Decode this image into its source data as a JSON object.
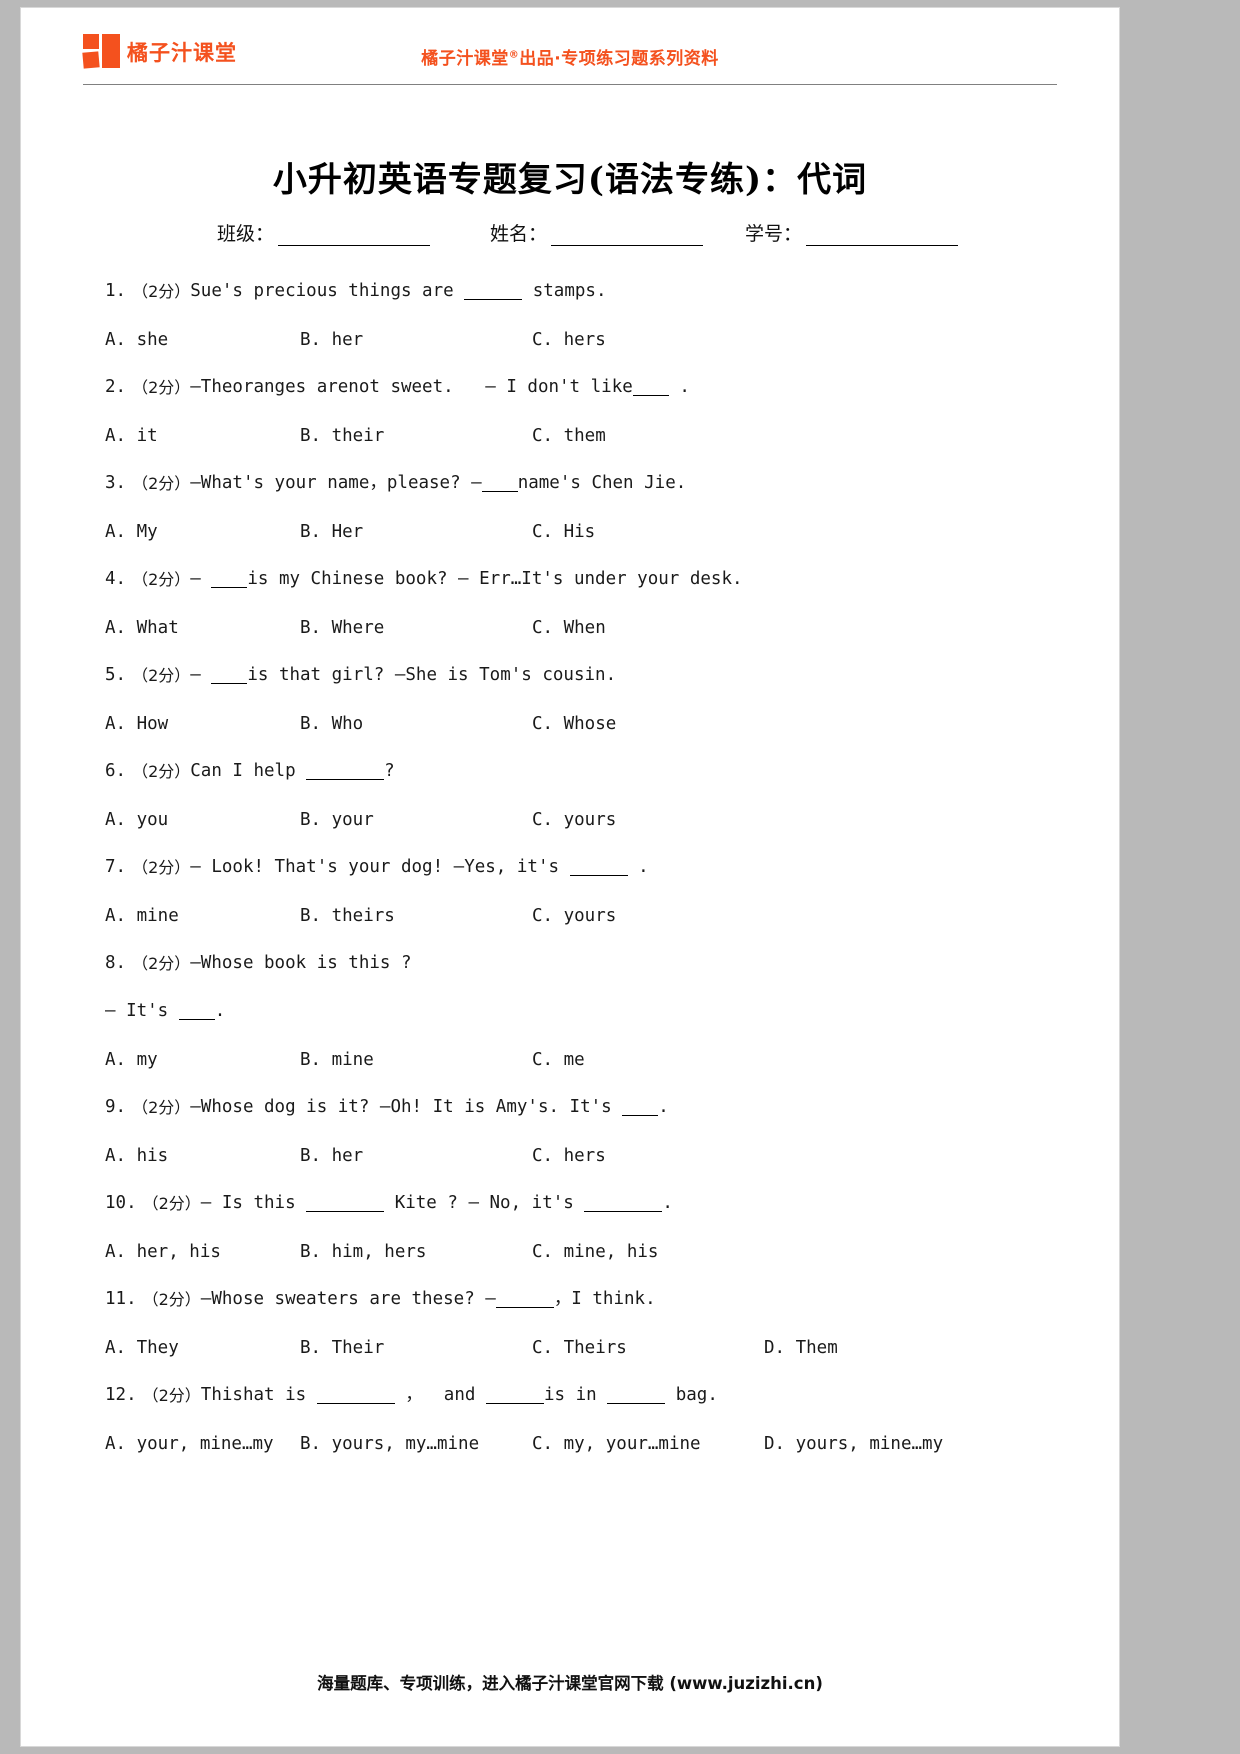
{
  "brand": {
    "logo_text": "橘子汁课堂",
    "logo_color": "#f4511e",
    "slogan_prefix": "橘子汁课堂",
    "slogan_mark": "®",
    "slogan_suffix": "出品·专项练习题系列资料"
  },
  "document": {
    "title": "小升初英语专题复习(语法专练)：代词",
    "info": {
      "class_label": "班级：",
      "name_label": "姓名：",
      "id_label": "学号："
    }
  },
  "questions": [
    {
      "number": "1.",
      "score": "（2分）",
      "stem_before": "Sue's precious things are ",
      "blank": "m",
      "stem_after": " stamps.",
      "options": [
        "A. she",
        "B. her",
        "C. hers"
      ]
    },
    {
      "number": "2.",
      "score": "（2分）",
      "stem_before": "—Theoranges arenot sweet.   — I don't like",
      "blank": "s",
      "stem_after": " .",
      "options": [
        "A. it",
        "B. their",
        "C. them"
      ]
    },
    {
      "number": "3.",
      "score": "（2分）",
      "stem_before": "—What's your name，please? —",
      "blank": "s",
      "stem_after": "name's Chen Jie.",
      "options": [
        "A. My",
        "B. Her",
        "C. His"
      ]
    },
    {
      "number": "4.",
      "score": "（2分）",
      "stem_before": "— ",
      "blank": "s",
      "stem_after": "is my Chinese book? — Err…It's under your desk.",
      "options": [
        "A. What",
        "B. Where",
        "C. When"
      ]
    },
    {
      "number": "5.",
      "score": "（2分）",
      "stem_before": "— ",
      "blank": "s",
      "stem_after": "is that girl? —She is Tom's cousin.",
      "options": [
        "A. How",
        "B. Who",
        "C. Whose"
      ]
    },
    {
      "number": "6.",
      "score": "（2分）",
      "stem_before": "Can I help ",
      "blank": "l",
      "stem_after": "?",
      "options": [
        "A. you",
        "B. your",
        "C. yours"
      ]
    },
    {
      "number": "7.",
      "score": "（2分）",
      "stem_before": "— Look! That's your dog! —Yes, it's ",
      "blank": "m",
      "stem_after": " .",
      "options": [
        "A. mine",
        "B. theirs",
        "C. yours"
      ]
    },
    {
      "number": "8.",
      "score": "（2分）",
      "stem_before": "—Whose book is this ?",
      "blank": "none",
      "stem_after": "",
      "line2_before": "— It's ",
      "line2_blank": "s",
      "line2_after": ".",
      "options": [
        "A. my",
        "B. mine",
        "C. me"
      ]
    },
    {
      "number": "9.",
      "score": "（2分）",
      "stem_before": "—Whose dog is it? —Oh! It is Amy's. It's ",
      "blank": "s",
      "stem_after": ".",
      "options": [
        "A. his",
        "B. her",
        "C. hers"
      ]
    },
    {
      "number": "10.",
      "score": "（2分）",
      "stem_before": "— Is this ",
      "blank": "l",
      "stem_after": " Kite ? — No, it's ",
      "blank2": "l",
      "stem_tail": ".",
      "options": [
        "A. her, his",
        "B. him, hers",
        "C. mine, his"
      ]
    },
    {
      "number": "11.",
      "score": "（2分）",
      "stem_before": "—Whose sweaters are these? —",
      "blank": "m",
      "stem_after": "，I think.",
      "options": [
        "A. They",
        "B. Their",
        "C. Theirs",
        "D. Them"
      ]
    },
    {
      "number": "12.",
      "score": "（2分）",
      "stem_before": "Thishat is ",
      "blank": "l",
      "stem_after": " ，  and ",
      "blank2": "m",
      "stem_tail": "is in ",
      "blank3": "m",
      "stem_end": " bag.",
      "options": [
        "A. your, mine…my",
        "B. yours, my…mine",
        "C. my, your…mine",
        "D. yours, mine…my"
      ]
    }
  ],
  "footer": {
    "text": "海量题库、专项训练，进入橘子汁课堂官网下载 (www.juzizhi.cn)"
  }
}
